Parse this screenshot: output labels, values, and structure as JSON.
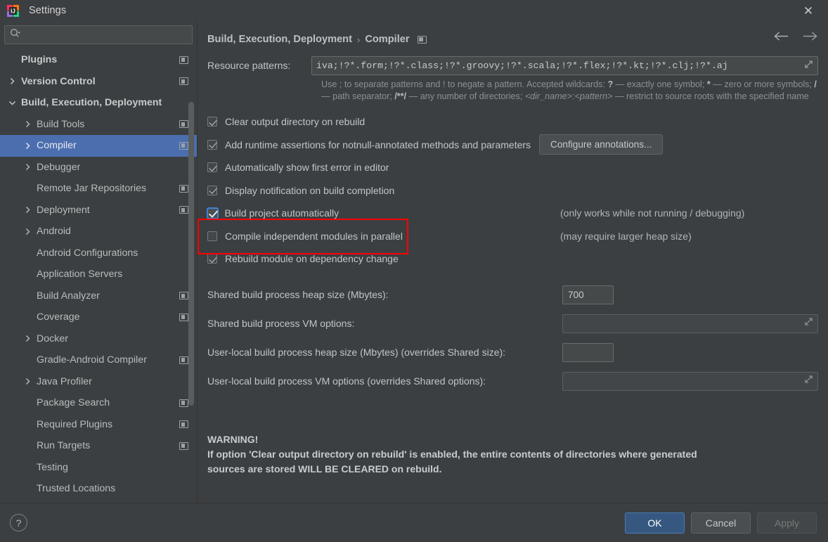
{
  "window": {
    "title": "Settings",
    "app_icon": "intellij-idea-icon",
    "close_label": "✕"
  },
  "sidebar": {
    "search": {
      "placeholder": "",
      "value": "",
      "icon": "search-icon"
    },
    "items": [
      {
        "label": "Plugins",
        "indent": 0,
        "arrow": "none",
        "bold": true,
        "badge": true,
        "selected": false
      },
      {
        "label": "Version Control",
        "indent": 0,
        "arrow": "collapsed",
        "bold": true,
        "badge": true,
        "selected": false
      },
      {
        "label": "Build, Execution, Deployment",
        "indent": 0,
        "arrow": "expanded",
        "bold": true,
        "badge": false,
        "selected": false
      },
      {
        "label": "Build Tools",
        "indent": 1,
        "arrow": "collapsed",
        "bold": false,
        "badge": true,
        "selected": false
      },
      {
        "label": "Compiler",
        "indent": 1,
        "arrow": "collapsed",
        "bold": false,
        "badge": true,
        "selected": true
      },
      {
        "label": "Debugger",
        "indent": 1,
        "arrow": "collapsed",
        "bold": false,
        "badge": false,
        "selected": false
      },
      {
        "label": "Remote Jar Repositories",
        "indent": 1,
        "arrow": "none",
        "bold": false,
        "badge": true,
        "selected": false
      },
      {
        "label": "Deployment",
        "indent": 1,
        "arrow": "collapsed",
        "bold": false,
        "badge": true,
        "selected": false
      },
      {
        "label": "Android",
        "indent": 1,
        "arrow": "collapsed",
        "bold": false,
        "badge": false,
        "selected": false
      },
      {
        "label": "Android Configurations",
        "indent": 1,
        "arrow": "none",
        "bold": false,
        "badge": false,
        "selected": false
      },
      {
        "label": "Application Servers",
        "indent": 1,
        "arrow": "none",
        "bold": false,
        "badge": false,
        "selected": false
      },
      {
        "label": "Build Analyzer",
        "indent": 1,
        "arrow": "none",
        "bold": false,
        "badge": true,
        "selected": false
      },
      {
        "label": "Coverage",
        "indent": 1,
        "arrow": "none",
        "bold": false,
        "badge": true,
        "selected": false
      },
      {
        "label": "Docker",
        "indent": 1,
        "arrow": "collapsed",
        "bold": false,
        "badge": false,
        "selected": false
      },
      {
        "label": "Gradle-Android Compiler",
        "indent": 1,
        "arrow": "none",
        "bold": false,
        "badge": true,
        "selected": false
      },
      {
        "label": "Java Profiler",
        "indent": 1,
        "arrow": "collapsed",
        "bold": false,
        "badge": false,
        "selected": false
      },
      {
        "label": "Package Search",
        "indent": 1,
        "arrow": "none",
        "bold": false,
        "badge": true,
        "selected": false
      },
      {
        "label": "Required Plugins",
        "indent": 1,
        "arrow": "none",
        "bold": false,
        "badge": true,
        "selected": false
      },
      {
        "label": "Run Targets",
        "indent": 1,
        "arrow": "none",
        "bold": false,
        "badge": true,
        "selected": false
      },
      {
        "label": "Testing",
        "indent": 1,
        "arrow": "none",
        "bold": false,
        "badge": false,
        "selected": false
      },
      {
        "label": "Trusted Locations",
        "indent": 1,
        "arrow": "none",
        "bold": false,
        "badge": false,
        "selected": false
      }
    ]
  },
  "main": {
    "breadcrumb": {
      "parent": "Build, Execution, Deployment",
      "separator": "›",
      "current": "Compiler"
    },
    "nav": {
      "back_icon": "arrow-left-icon",
      "forward_icon": "arrow-right-icon"
    },
    "resource_patterns": {
      "label": "Resource patterns:",
      "value": "iva;!?*.form;!?*.class;!?*.groovy;!?*.scala;!?*.flex;!?*.kt;!?*.clj;!?*.aj",
      "expand_icon": "expand-editor-icon",
      "help_line1_a": "Use ; to separate patterns and ! to negate a pattern. Accepted wildcards: ",
      "help_wild1": "?",
      "help_line1_b": " — exactly one symbol; ",
      "help_wild2": "*",
      "help_line1_c": " — zero or more symbols; ",
      "help_wild3": "/",
      "help_line1_d": " — path separator; ",
      "help_wild4": "/**/",
      "help_line1_e": " — any number of directories;  ",
      "help_italic1": "<dir_name>",
      "help_sep1": ":",
      "help_italic2": "<pattern>",
      "help_line1_f": " — restrict to source roots with the specified name"
    },
    "checkboxes": [
      {
        "label": "Clear output directory on rebuild",
        "checked": true,
        "focused": false,
        "note": "",
        "button": ""
      },
      {
        "label": "Add runtime assertions for notnull-annotated methods and parameters",
        "checked": true,
        "focused": false,
        "note": "",
        "button": "Configure annotations..."
      },
      {
        "label": "Automatically show first error in editor",
        "checked": true,
        "focused": false,
        "note": "",
        "button": ""
      },
      {
        "label": "Display notification on build completion",
        "checked": true,
        "focused": false,
        "note": "",
        "button": ""
      },
      {
        "label": "Build project automatically",
        "checked": true,
        "focused": true,
        "note": "(only works while not running / debugging)",
        "button": ""
      },
      {
        "label": "Compile independent modules in parallel",
        "checked": false,
        "focused": false,
        "note": "(may require larger heap size)",
        "button": ""
      },
      {
        "label": "Rebuild module on dependency change",
        "checked": true,
        "focused": false,
        "note": "",
        "button": ""
      }
    ],
    "fields": [
      {
        "label": "Shared build process heap size (Mbytes):",
        "value": "700",
        "placeholder": "",
        "size": "small"
      },
      {
        "label": "Shared build process VM options:",
        "value": "",
        "placeholder": "",
        "size": "large"
      },
      {
        "label": "User-local build process heap size (Mbytes) (overrides Shared size):",
        "value": "",
        "placeholder": "",
        "size": "small"
      },
      {
        "label": "User-local build process VM options (overrides Shared options):",
        "value": "",
        "placeholder": "",
        "size": "large"
      }
    ],
    "warning": {
      "title": "WARNING!",
      "line1": "If option 'Clear output directory on rebuild' is enabled, the entire contents of directories where generated",
      "line2": "sources are stored WILL BE CLEARED on rebuild."
    }
  },
  "footer": {
    "help_label": "?",
    "ok_label": "OK",
    "cancel_label": "Cancel",
    "apply_label": "Apply"
  },
  "colors": {
    "background": "#3c3f41",
    "selection": "#4b6eaf",
    "accent": "#365880",
    "annotation": "#ff0000",
    "text": "#c2c5c7",
    "muted": "#8d9194"
  }
}
